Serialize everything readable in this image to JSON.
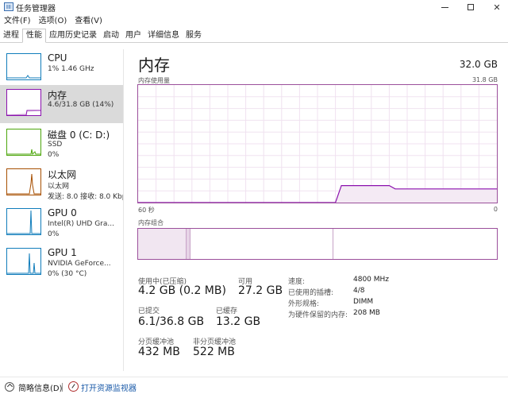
{
  "window": {
    "title": "任务管理器",
    "minimize_icon": "minimize-icon",
    "maximize_icon": "maximize-icon",
    "close_glyph": "✕"
  },
  "menu": [
    "文件(F)",
    "选项(O)",
    "查看(V)"
  ],
  "tabs": [
    {
      "label": "进程",
      "active": false
    },
    {
      "label": "性能",
      "active": true
    },
    {
      "label": "应用历史记录",
      "active": false
    },
    {
      "label": "启动",
      "active": false
    },
    {
      "label": "用户",
      "active": false
    },
    {
      "label": "详细信息",
      "active": false
    },
    {
      "label": "服务",
      "active": false
    }
  ],
  "sidebar": {
    "items": [
      {
        "title": "CPU",
        "line1": "1% 1.46 GHz",
        "line2": "",
        "color": "#117dbb",
        "selected": false
      },
      {
        "title": "内存",
        "line1": "4.6/31.8 GB (14%)",
        "line2": "",
        "color": "#8b12ae",
        "selected": true
      },
      {
        "title": "磁盘 0 (C: D:)",
        "line1": "SSD",
        "line2": "0%",
        "color": "#4da60c",
        "selected": false
      },
      {
        "title": "以太网",
        "line1": "以太网",
        "line2": "发送: 8.0  接收: 8.0 Kbp",
        "color": "#a74f01",
        "selected": false
      },
      {
        "title": "GPU 0",
        "line1": "Intel(R) UHD Gra...",
        "line2": "0%",
        "color": "#117dbb",
        "selected": false
      },
      {
        "title": "GPU 1",
        "line1": "NVIDIA GeForce...",
        "line2": "0% (30 °C)",
        "color": "#117dbb",
        "selected": false
      }
    ]
  },
  "main": {
    "title": "内存",
    "capacity": "32.0 GB",
    "usage_label": "内存使用量",
    "usage_max": "31.8 GB",
    "axis_left": "60 秒",
    "axis_right": "0",
    "composition_label": "内存组合",
    "accent": "#8b12ae"
  },
  "chart_data": {
    "type": "area",
    "title": "",
    "xlabel": "",
    "ylabel": "",
    "x_range_seconds": [
      60,
      0
    ],
    "ylim": [
      0,
      31.8
    ],
    "series": [
      {
        "name": "",
        "x": [
          60,
          27,
          26,
          18,
          17,
          0
        ],
        "values": [
          0,
          0,
          4.6,
          4.6,
          3.7,
          3.7
        ]
      }
    ]
  },
  "stats": {
    "in_use_label": "使用中(已压缩)",
    "in_use_value": "4.2 GB (0.2 MB)",
    "available_label": "可用",
    "available_value": "27.2 GB",
    "committed_label": "已提交",
    "committed_value": "6.1/36.8 GB",
    "cached_label": "已缓存",
    "cached_value": "13.2 GB",
    "paged_label": "分页缓冲池",
    "paged_value": "432 MB",
    "nonpaged_label": "非分页缓冲池",
    "nonpaged_value": "522 MB"
  },
  "specs": [
    {
      "label": "速度:",
      "value": "4800 MHz"
    },
    {
      "label": "已使用的插槽:",
      "value": "4/8"
    },
    {
      "label": "外形规格:",
      "value": "DIMM"
    },
    {
      "label": "为硬件保留的内存:",
      "value": "208 MB"
    }
  ],
  "bottom": {
    "fewer_details": "简略信息(D)",
    "resource_monitor": "打开资源监视器"
  }
}
